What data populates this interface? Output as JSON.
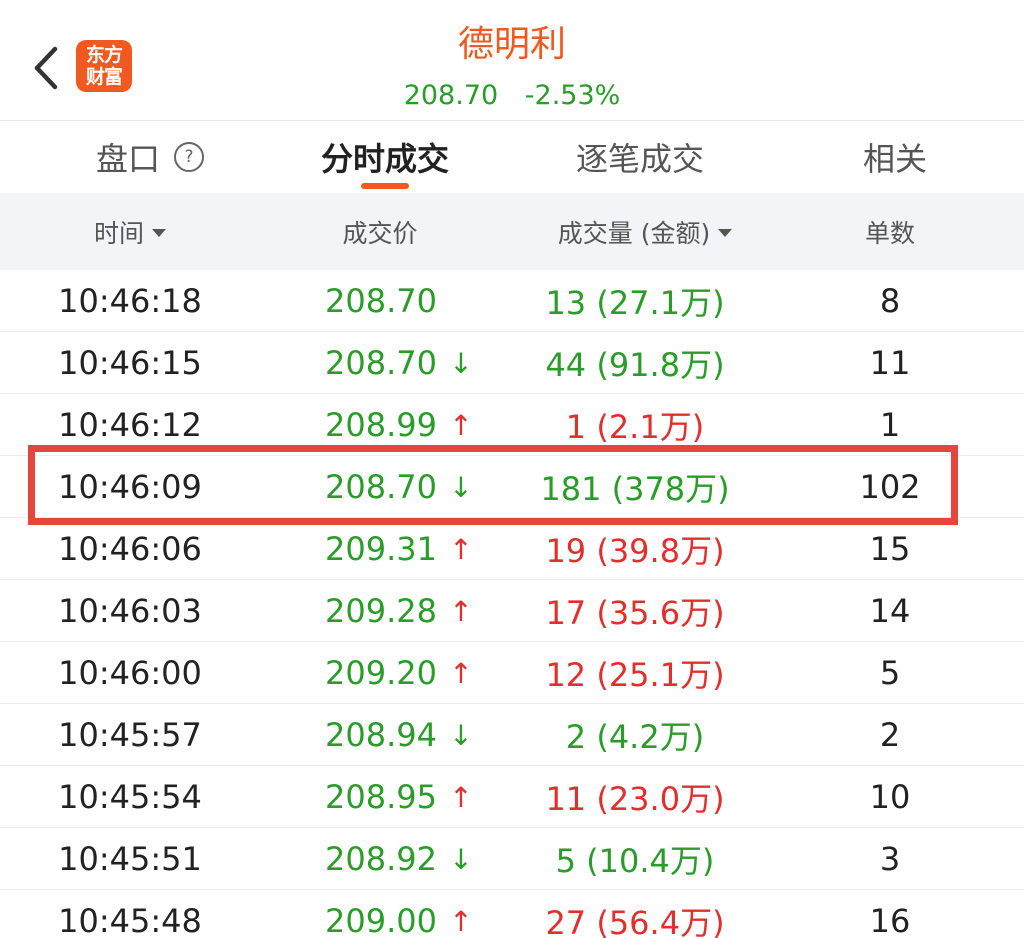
{
  "header": {
    "logo_line1": "东方",
    "logo_line2": "财富",
    "stock_name": "德明利",
    "price": "208.70",
    "change": "-2.53%"
  },
  "tabs": [
    {
      "label": "盘口",
      "active": false
    },
    {
      "label": "分时成交",
      "active": true
    },
    {
      "label": "逐笔成交",
      "active": false
    },
    {
      "label": "相关",
      "active": false
    }
  ],
  "help_icon_label": "?",
  "columns": {
    "time": "时间",
    "price": "成交价",
    "volume": "成交量 (金额)",
    "count": "单数"
  },
  "rows": [
    {
      "time": "10:46:18",
      "price": "208.70",
      "dir": "none",
      "volume": "13 (27.1万)",
      "vol_color": "down",
      "count": "8"
    },
    {
      "time": "10:46:15",
      "price": "208.70",
      "dir": "down",
      "volume": "44 (91.8万)",
      "vol_color": "down",
      "count": "11"
    },
    {
      "time": "10:46:12",
      "price": "208.99",
      "dir": "up",
      "volume": "1 (2.1万)",
      "vol_color": "up",
      "count": "1"
    },
    {
      "time": "10:46:09",
      "price": "208.70",
      "dir": "down",
      "volume": "181 (378万)",
      "vol_color": "down",
      "count": "102"
    },
    {
      "time": "10:46:06",
      "price": "209.31",
      "dir": "up",
      "volume": "19 (39.8万)",
      "vol_color": "up",
      "count": "15"
    },
    {
      "time": "10:46:03",
      "price": "209.28",
      "dir": "up",
      "volume": "17 (35.6万)",
      "vol_color": "up",
      "count": "14"
    },
    {
      "time": "10:46:00",
      "price": "209.20",
      "dir": "up",
      "volume": "12 (25.1万)",
      "vol_color": "up",
      "count": "5"
    },
    {
      "time": "10:45:57",
      "price": "208.94",
      "dir": "down",
      "volume": "2 (4.2万)",
      "vol_color": "down",
      "count": "2"
    },
    {
      "time": "10:45:54",
      "price": "208.95",
      "dir": "up",
      "volume": "11 (23.0万)",
      "vol_color": "up",
      "count": "10"
    },
    {
      "time": "10:45:51",
      "price": "208.92",
      "dir": "down",
      "volume": "5 (10.4万)",
      "vol_color": "down",
      "count": "3"
    },
    {
      "time": "10:45:48",
      "price": "209.00",
      "dir": "up",
      "volume": "27 (56.4万)",
      "vol_color": "up",
      "count": "16"
    }
  ],
  "arrows": {
    "up": "↑",
    "down": "↓",
    "none": "↓"
  },
  "colors": {
    "brand": "#f0591f",
    "rise": "#e0302e",
    "fall": "#2a9c2a",
    "highlight": "#e5463b"
  }
}
